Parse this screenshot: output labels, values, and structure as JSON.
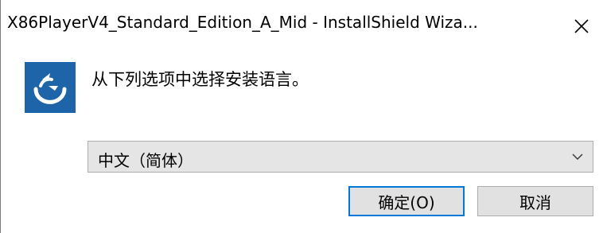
{
  "window": {
    "title": "X86PlayerV4_Standard_Edition_A_Mid - InstallShield Wiza..."
  },
  "titlebar": {
    "close_icon": "close-icon"
  },
  "dialog": {
    "app_icon": "installshield-icon",
    "prompt": "从下列选项中选择安装语言。",
    "language_select": {
      "selected": "中文（简体）",
      "arrow_icon": "chevron-down-icon"
    },
    "buttons": {
      "ok": "确定(O)",
      "cancel": "取消"
    }
  },
  "colors": {
    "accent": "#0078d7",
    "icon_bg": "#1d64a8"
  }
}
